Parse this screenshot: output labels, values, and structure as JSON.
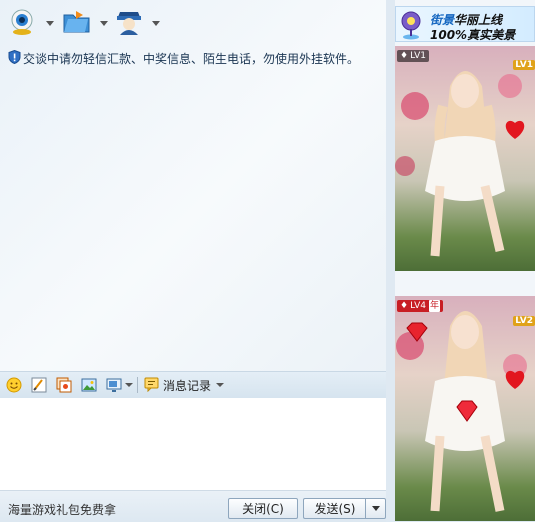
{
  "toolbar": {
    "buttons": [
      {
        "name": "video-call",
        "icon": "webcam-icon"
      },
      {
        "name": "send-file",
        "icon": "folder-icon"
      },
      {
        "name": "remote-assist",
        "icon": "assistant-icon"
      }
    ]
  },
  "chat": {
    "warning": "交谈中请勿轻信汇款、中奖信息、陌生电话，勿使用外挂软件。"
  },
  "input_toolbar": {
    "history_label": "消息记录"
  },
  "footer": {
    "promo": "海量游戏礼包免费拿",
    "close_label": "关闭(C)",
    "send_label": "发送(S)"
  },
  "ad": {
    "line1_blue": "街景",
    "line1_rest": "华丽上线",
    "line2": "100%真实美景"
  },
  "videos": [
    {
      "badge": "LV1",
      "gold_badge": "LV1"
    },
    {
      "badge": "LV4",
      "badge_extra": "年",
      "gold_badge": "LV2"
    }
  ],
  "colors": {
    "accent_blue": "#1466c0",
    "badge_red": "#c81e24",
    "badge_gold": "#e0a21a"
  }
}
